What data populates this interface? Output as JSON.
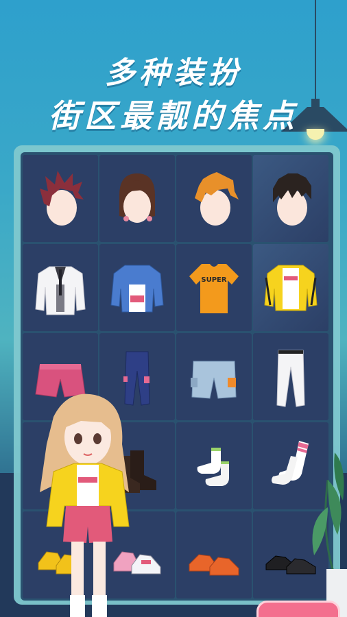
{
  "banner": {
    "line1": "多种装扮",
    "line2": "街区最靓的焦点"
  },
  "colors": {
    "panel_border": "#7fc8cf",
    "cell_bg": "#2c3f66",
    "title_text": "#ffffff"
  },
  "wardrobe": {
    "rows": [
      {
        "category": "hair",
        "items": [
          "red-spiky-hair-icon",
          "brown-bob-hair-icon",
          "orange-shaggy-hair-icon",
          "black-messy-hair-icon"
        ]
      },
      {
        "category": "tops",
        "items": [
          "white-suit-jacket-icon",
          "blue-denim-jacket-icon",
          "orange-super-tshirt-icon",
          "yellow-bomber-jacket-icon"
        ]
      },
      {
        "category": "bottoms",
        "items": [
          "pink-shorts-icon",
          "navy-jogger-pants-icon",
          "denim-cargo-shorts-icon",
          "white-jeans-icon"
        ]
      },
      {
        "category": "socks",
        "items": [
          "hidden-item-icon",
          "black-boots-icon",
          "white-ankle-socks-icon",
          "white-striped-socks-icon"
        ]
      },
      {
        "category": "shoes",
        "items": [
          "yellow-sneakers-icon",
          "pink-sneakers-icon",
          "orange-brogues-icon",
          "black-dress-shoes-icon"
        ]
      }
    ]
  },
  "super_label": "SUPER"
}
